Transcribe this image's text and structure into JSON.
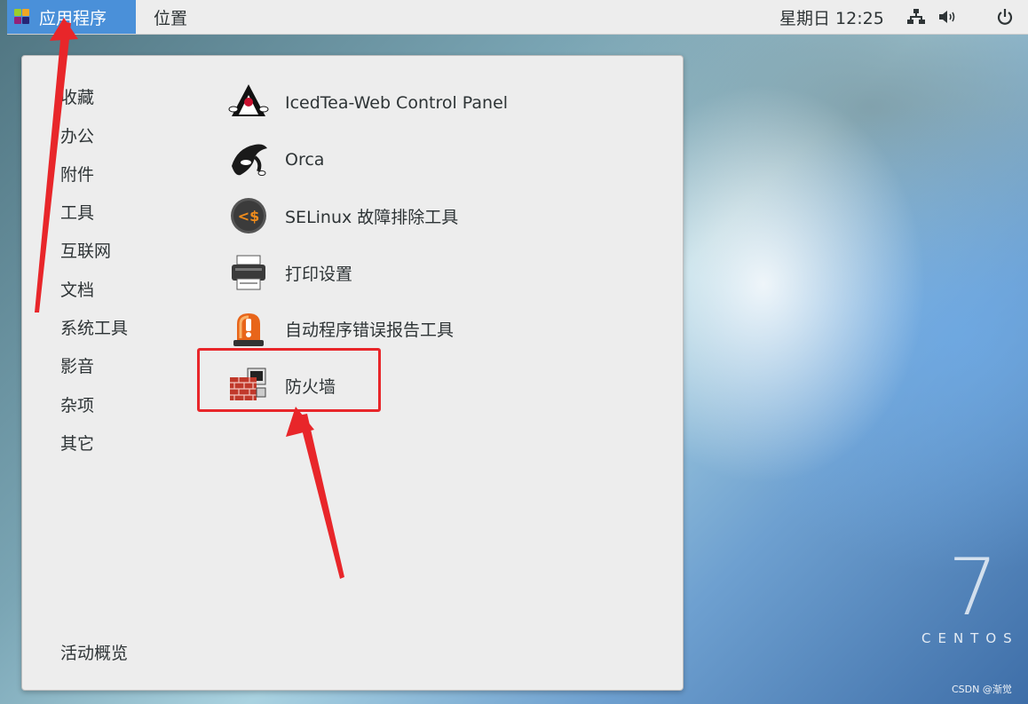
{
  "topbar": {
    "applications_label": "应用程序",
    "places_label": "位置",
    "clock": "星期日 12:25",
    "tray": {
      "network_icon": "network-icon",
      "volume_icon": "volume-icon",
      "power_icon": "power-icon"
    }
  },
  "menu": {
    "categories": [
      "收藏",
      "办公",
      "附件",
      "工具",
      "互联网",
      "文档",
      "系统工具",
      "影音",
      "杂项",
      "其它"
    ],
    "apps": [
      {
        "label": "IcedTea-Web Control Panel",
        "icon": "java-duke-icon"
      },
      {
        "label": "Orca",
        "icon": "orca-icon"
      },
      {
        "label": "SELinux 故障排除工具",
        "icon": "selinux-icon"
      },
      {
        "label": "打印设置",
        "icon": "printer-icon"
      },
      {
        "label": "自动程序错误报告工具",
        "icon": "alarm-icon"
      },
      {
        "label": "防火墙",
        "icon": "firewall-icon"
      }
    ],
    "activities_label": "活动概览"
  },
  "desktop": {
    "centos_number": "7",
    "centos_word": "CENTOS",
    "watermark": "CSDN @渐觉"
  },
  "colors": {
    "accent": "#4a90d9",
    "annotation": "#e8262a"
  }
}
